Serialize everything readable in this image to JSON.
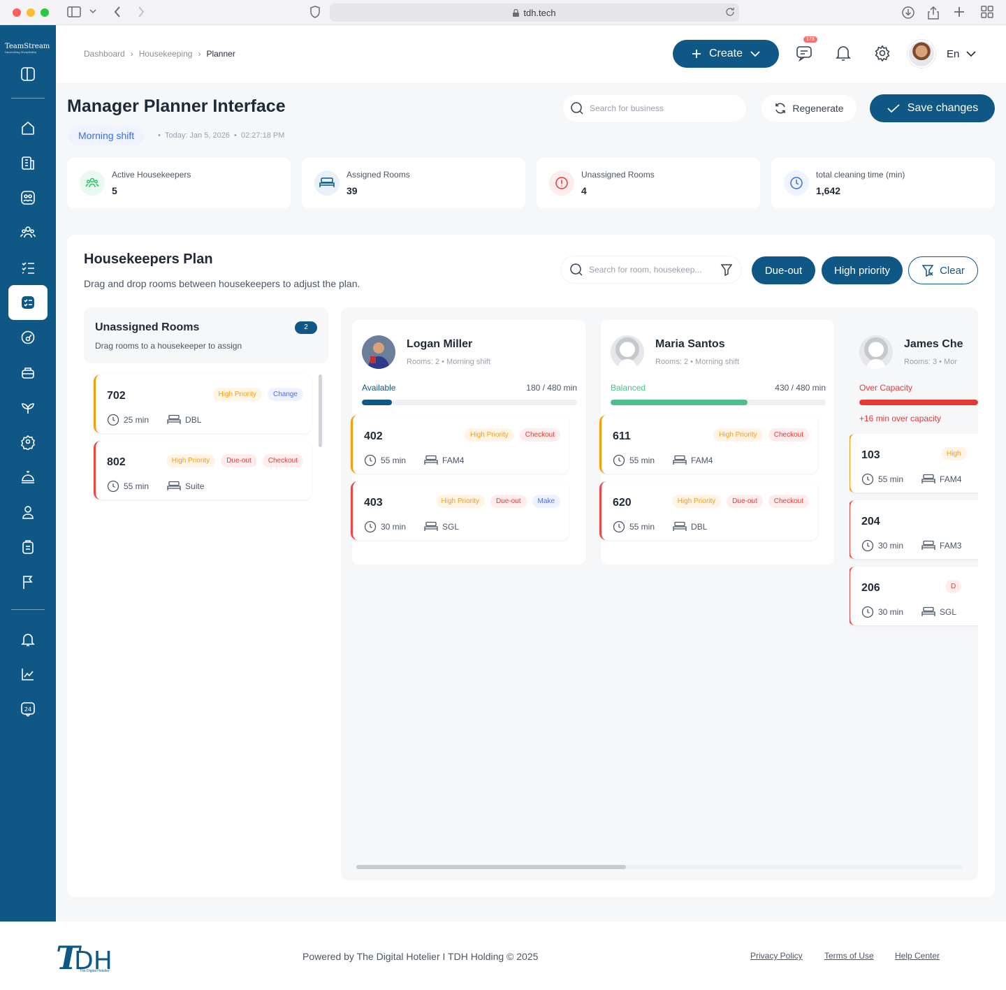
{
  "browser": {
    "url": "tdh.tech"
  },
  "brand": {
    "name": "TeamStream",
    "tagline": "Innovating Hospitality"
  },
  "breadcrumb": [
    "Dashboard",
    "Housekeeping",
    "Planner"
  ],
  "topbar": {
    "create_label": "Create",
    "messages_badge": "173",
    "language": "En"
  },
  "header": {
    "title": "Manager Planner Interface",
    "shift": "Morning shift",
    "today": "Today: Jan 5, 2026",
    "time": "02:27:18 PM",
    "search_placeholder": "Search for business",
    "regenerate_label": "Regenerate",
    "save_label": "Save changes"
  },
  "stats": [
    {
      "label": "Active Housekeepers",
      "value": "5",
      "icon": "users-icon",
      "color": "#22c55e"
    },
    {
      "label": "Assigned Rooms",
      "value": "39",
      "icon": "bed-icon",
      "color": "#0f5785"
    },
    {
      "label": "Unassigned Rooms",
      "value": "4",
      "icon": "alert-icon",
      "color": "#e53935"
    },
    {
      "label": "total cleaning time (min)",
      "value": "1,642",
      "icon": "clock-icon",
      "color": "#3b6fe0"
    }
  ],
  "plan": {
    "title": "Housekeepers Plan",
    "subtitle": "Drag and drop rooms between housekeepers to adjust the plan.",
    "search_placeholder": "Search for room, housekeep...",
    "filter_dueout": "Due-out",
    "filter_high": "High priority",
    "clear_label": "Clear"
  },
  "unassigned": {
    "title": "Unassigned Rooms",
    "count": "2",
    "subtitle": "Drag rooms to a housekeeper to assign",
    "rooms": [
      {
        "number": "702",
        "tags": [
          "High Priority",
          "Change"
        ],
        "time": "25 min",
        "type": "DBL"
      },
      {
        "number": "802",
        "tags": [
          "High Priority",
          "Due-out",
          "Checkout"
        ],
        "time": "55 min",
        "type": "Suite"
      }
    ]
  },
  "housekeepers": [
    {
      "name": "Logan Miller",
      "meta": "Rooms: 2 • Morning shift",
      "status": "Available",
      "load": "180 / 480 min",
      "load_fraction": 0.14,
      "status_color": "#0f5785",
      "rooms": [
        {
          "number": "402",
          "tags": [
            "High Priority",
            "Checkout"
          ],
          "time": "55 min",
          "type": "FAM4"
        },
        {
          "number": "403",
          "tags": [
            "High Priority",
            "Due-out",
            "Make"
          ],
          "time": "30 min",
          "type": "SGL"
        }
      ]
    },
    {
      "name": "Maria Santos",
      "meta": "Rooms: 2 • Morning shift",
      "status": "Balanced",
      "load": "430 / 480 min",
      "load_fraction": 0.635,
      "status_color": "#4cbf8a",
      "rooms": [
        {
          "number": "611",
          "tags": [
            "High Priority",
            "Checkout"
          ],
          "time": "55 min",
          "type": "FAM4"
        },
        {
          "number": "620",
          "tags": [
            "High Priority",
            "Due-out",
            "Checkout"
          ],
          "time": "55 min",
          "type": "DBL"
        }
      ]
    },
    {
      "name": "James Che",
      "meta": "Rooms: 3 • Mor",
      "status": "Over Capacity",
      "note": "+16 min over capacity",
      "load_fraction": 1.0,
      "status_color": "#e53935",
      "rooms": [
        {
          "number": "103",
          "tags": [
            "High"
          ],
          "time": "55 min",
          "type": "FAM4"
        },
        {
          "number": "204",
          "tags": [],
          "time": "30 min",
          "type": "FAM3"
        },
        {
          "number": "206",
          "tags": [
            "D"
          ],
          "time": "30 min",
          "type": "SGL"
        }
      ]
    }
  ],
  "footer": {
    "powered": "Powered by The Digital Hotelier I TDH Holding © 2025",
    "logo_text": "TDH",
    "logo_sub": "The Digital Hotelier",
    "links": [
      "Privacy Policy",
      "Terms of Use",
      "Help Center"
    ]
  }
}
